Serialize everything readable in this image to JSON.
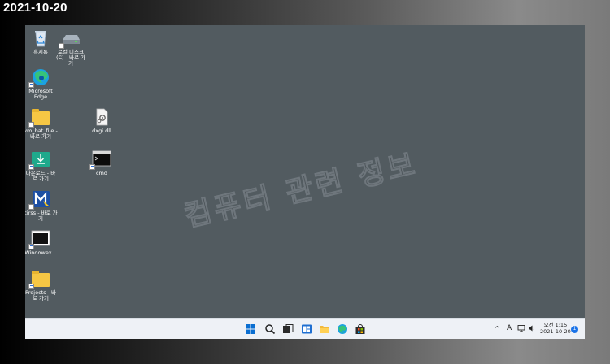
{
  "datestamp": "2021-10-20",
  "watermark": "컴퓨터 관련 정보",
  "desktop_icons": [
    {
      "label": "휴지통"
    },
    {
      "label": "로컬 디스크 (C) - 바로 가기"
    },
    {
      "label": "Microsoft Edge"
    },
    {
      "label": "vm_bat_file - 바로 가기"
    },
    {
      "label": "dxgi.dll"
    },
    {
      "label": "다운로드 - 바로 가기"
    },
    {
      "label": "cmd"
    },
    {
      "label": "cirss - 바로 가기"
    },
    {
      "label": "Windowex..."
    },
    {
      "label": "Projects - 바로 가기"
    }
  ],
  "taskbar": {
    "apps": [
      "start-icon",
      "search-icon",
      "task-view-icon",
      "widgets-icon",
      "file-explorer-icon",
      "edge-icon",
      "store-icon"
    ],
    "tray": {
      "chevron": "^",
      "ime": "A",
      "clock_time": "오전 1:15",
      "clock_date": "2021-10-20",
      "notification_count": "1"
    }
  },
  "colors": {
    "desktop": "#525b60",
    "taskbar": "#eef1f6",
    "folder": "#f6c744",
    "accent": "#1a73e8"
  }
}
